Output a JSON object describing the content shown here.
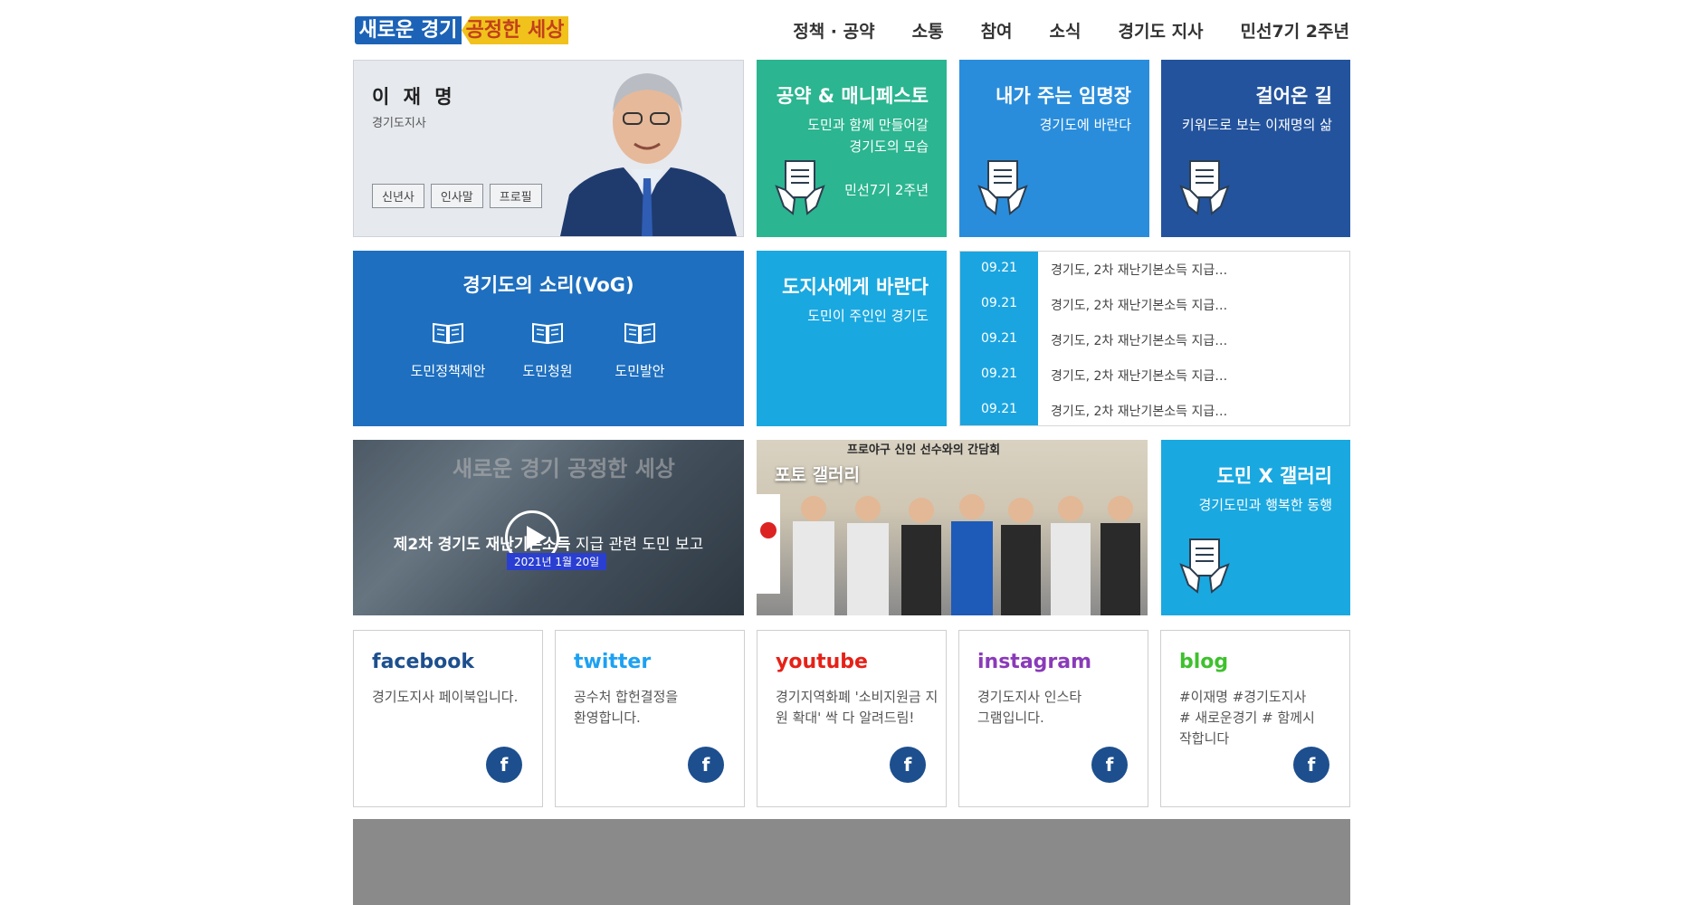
{
  "header": {
    "logo_left": "새로운 경기",
    "logo_right": "공정한 세상",
    "nav": [
      "정책 · 공약",
      "소통",
      "참여",
      "소식",
      "경기도 지사",
      "민선7기 2주년"
    ]
  },
  "profile": {
    "name": "이 재 명",
    "role": "경기도지사",
    "buttons": [
      "신년사",
      "인사말",
      "프로필"
    ]
  },
  "tiles": {
    "pledge": {
      "title": "공약 & 매니페스토",
      "sub1": "도민과 함께 만들어갈",
      "sub2": "경기도의 모습",
      "sub3": "민선7기 2주년",
      "color": "#2bb590"
    },
    "appointment": {
      "title": "내가 주는 임명장",
      "sub1": "경기도에 바란다",
      "color": "#2a8ddb"
    },
    "road": {
      "title": "걸어온 길",
      "sub1": "키워드로 보는 이재명의 삶",
      "color": "#23539d"
    },
    "wish": {
      "title": "도지사에게 바란다",
      "sub1": "도민이 주인인 경기도",
      "color": "#1aa8e0"
    },
    "xgallery": {
      "title": "도민 X 갤러리",
      "sub1": "경기도민과 행복한 동행",
      "color": "#1aa8e0"
    }
  },
  "vog": {
    "title": "경기도의 소리(VoG)",
    "items": [
      "도민정책제안",
      "도민청원",
      "도민발안"
    ]
  },
  "news": [
    {
      "date": "09.21",
      "text": "경기도, 2차 재난기본소득 지급…"
    },
    {
      "date": "09.21",
      "text": "경기도, 2차 재난기본소득 지급…"
    },
    {
      "date": "09.21",
      "text": "경기도, 2차 재난기본소득 지급…"
    },
    {
      "date": "09.21",
      "text": "경기도, 2차 재난기본소득 지급…"
    },
    {
      "date": "09.21",
      "text": "경기도, 2차 재난기본소득 지급…"
    }
  ],
  "video": {
    "backdrop": "새로운 경기 공정한 세상",
    "caption_bold": "제2차 경기도 재난기본소득",
    "caption_rest": " 지급 관련 도민 보고",
    "date": "2021년 1월 20일"
  },
  "photo": {
    "label": "포토 갤러리",
    "banner": "프로야구 신인 선수와의 간담회"
  },
  "social": [
    {
      "title": "facebook",
      "desc": "경기도지사 페이북입니다.",
      "color": "#1d4f8e"
    },
    {
      "title": "twitter",
      "desc": "공수처 합헌결정을 환영합니다.",
      "color": "#1da1f2"
    },
    {
      "title": "youtube",
      "desc": "경기지역화폐 '소비지원금 지원 확대' 싹 다 알려드림!",
      "color": "#e62117"
    },
    {
      "title": "instagram",
      "desc": "경기도지사 인스타그램입니다.",
      "color": "#8a3ab9"
    },
    {
      "title": "blog",
      "desc": "#이재명 #경기도지사 # 새로운경기 # 함께시작합니다",
      "color": "#3ec12d"
    }
  ],
  "social_button_icon": "f",
  "icons": {
    "document": "document-hands-icon",
    "book": "book-icon",
    "play": "play-icon"
  }
}
